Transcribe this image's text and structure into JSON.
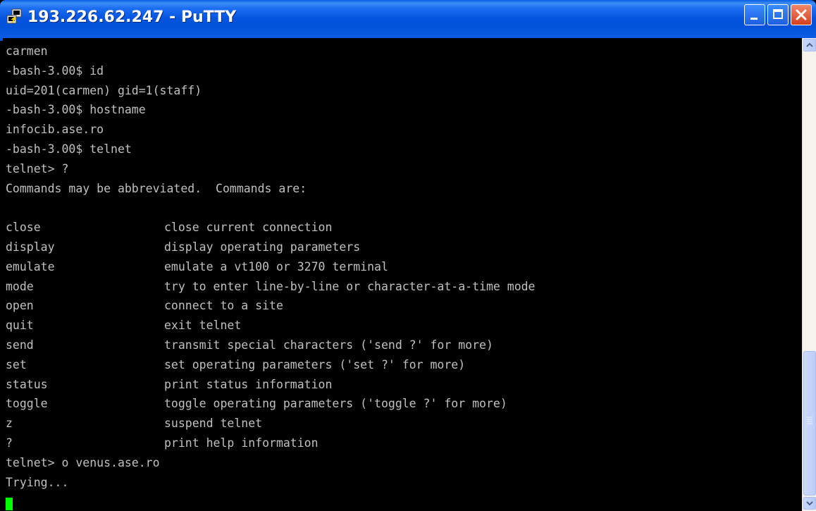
{
  "window": {
    "title": "193.226.62.247 - PuTTY",
    "icons": [
      "putty-app-icon",
      "minimize-icon",
      "maximize-icon",
      "close-icon"
    ]
  },
  "terminal": {
    "lines": [
      "carmen",
      "-bash-3.00$ id",
      "uid=201(carmen) gid=1(staff)",
      "-bash-3.00$ hostname",
      "infocib.ase.ro",
      "-bash-3.00$ telnet",
      "telnet> ?",
      "Commands may be abbreviated.  Commands are:",
      ""
    ],
    "commands": [
      {
        "name": "close",
        "desc": "close current connection"
      },
      {
        "name": "display",
        "desc": "display operating parameters"
      },
      {
        "name": "emulate",
        "desc": "emulate a vt100 or 3270 terminal"
      },
      {
        "name": "mode",
        "desc": "try to enter line-by-line or character-at-a-time mode"
      },
      {
        "name": "open",
        "desc": "connect to a site"
      },
      {
        "name": "quit",
        "desc": "exit telnet"
      },
      {
        "name": "send",
        "desc": "transmit special characters ('send ?' for more)"
      },
      {
        "name": "set",
        "desc": "set operating parameters ('set ?' for more)"
      },
      {
        "name": "status",
        "desc": "print status information"
      },
      {
        "name": "toggle",
        "desc": "toggle operating parameters ('toggle ?' for more)"
      },
      {
        "name": "z",
        "desc": "suspend telnet"
      },
      {
        "name": "?",
        "desc": "print help information"
      }
    ],
    "after_lines": [
      "telnet> o venus.ase.ro",
      "Trying..."
    ],
    "colors": {
      "background": "#000000",
      "foreground": "#c0c0c0",
      "cursor": "#00ff00"
    }
  },
  "scrollbar": {
    "position_fraction": 1.0
  }
}
